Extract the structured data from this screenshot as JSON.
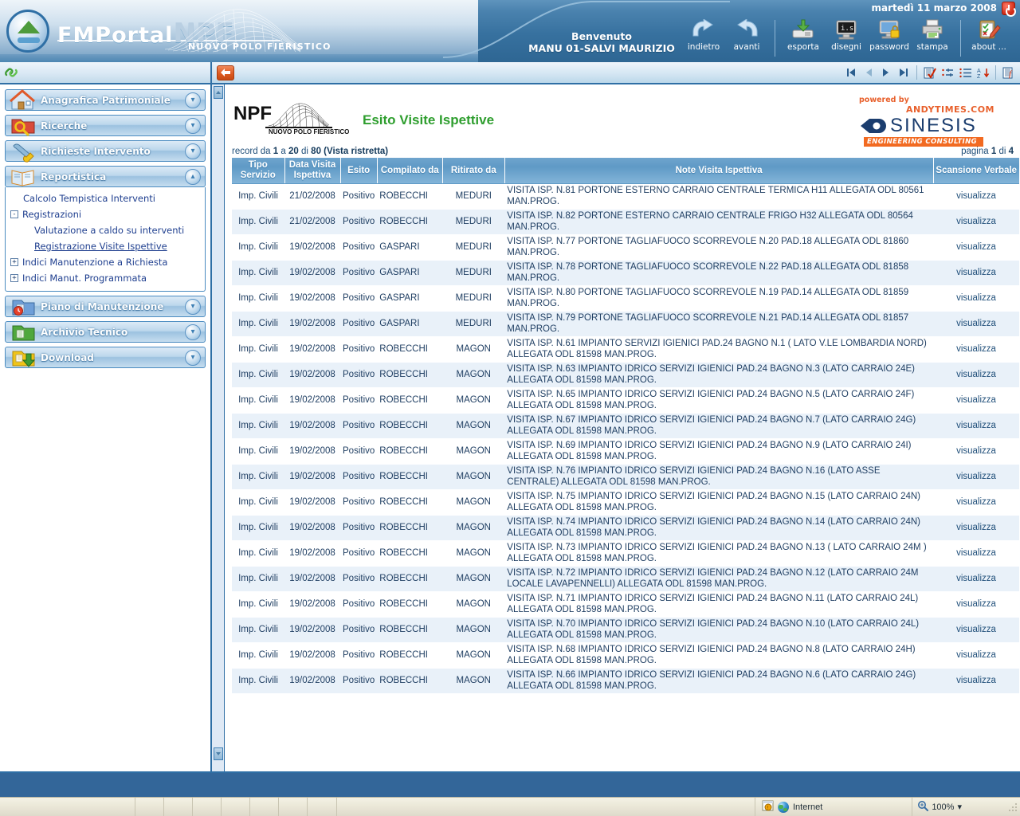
{
  "header": {
    "brand_fm": "FMPortal",
    "brand_npf": "NPF",
    "brand_sub": "NUOVO POLO FIERISTICO",
    "welcome_label": "Benvenuto",
    "welcome_user": "MANU 01-SALVI MAURIZIO",
    "date": "martedì 11 marzo 2008",
    "power_icon": "power-off-icon",
    "toolbar": [
      {
        "label": "indietro",
        "icon": "arrow-back-icon"
      },
      {
        "label": "avanti",
        "icon": "arrow-forward-icon"
      },
      {
        "label": "esporta",
        "icon": "export-disk-icon"
      },
      {
        "label": "disegni",
        "icon": "drawings-monitor-icon"
      },
      {
        "label": "password",
        "icon": "password-lock-icon"
      },
      {
        "label": "stampa",
        "icon": "printer-icon"
      },
      {
        "label": "about ...",
        "icon": "about-clipboard-icon"
      }
    ]
  },
  "subbar": {
    "link_icon": "link-chain-icon",
    "back_icon": "back-arrow-icon",
    "nav": [
      {
        "name": "first-record",
        "icon": "first-icon"
      },
      {
        "name": "previous-record",
        "icon": "previous-icon"
      },
      {
        "name": "next-record",
        "icon": "next-icon"
      },
      {
        "name": "last-record",
        "icon": "last-icon"
      },
      {
        "name": "validate",
        "icon": "checklist-icon"
      },
      {
        "name": "filter",
        "icon": "filter-icon"
      },
      {
        "name": "list-view",
        "icon": "list-icon"
      },
      {
        "name": "sort-az",
        "icon": "sort-az-icon"
      },
      {
        "name": "function",
        "icon": "function-icon"
      }
    ]
  },
  "sidebar": {
    "groups": [
      {
        "label": "Anagrafica Patrimoniale",
        "icon": "house-icon",
        "expanded": false,
        "chevron": "chevron-down-icon"
      },
      {
        "label": "Ricerche",
        "icon": "search-folder-icon",
        "expanded": false,
        "chevron": "chevron-down-icon"
      },
      {
        "label": "Richieste Intervento",
        "icon": "wrench-icon",
        "expanded": false,
        "chevron": "chevron-down-icon"
      },
      {
        "label": "Reportistica",
        "icon": "book-icon",
        "expanded": true,
        "chevron": "chevron-up-icon"
      },
      {
        "label": "Piano di Manutenzione",
        "icon": "calendar-clock-icon",
        "expanded": false,
        "chevron": "chevron-down-icon"
      },
      {
        "label": "Archivio Tecnico",
        "icon": "green-folder-icon",
        "expanded": false,
        "chevron": "chevron-down-icon"
      },
      {
        "label": "Download",
        "icon": "download-folder-icon",
        "expanded": false,
        "chevron": "chevron-down-icon"
      }
    ],
    "reportistica_items": [
      {
        "label": "Calcolo Tempistica Interventi",
        "indent": 1,
        "toggle": null,
        "active": false
      },
      {
        "label": "Registrazioni",
        "indent": 0,
        "toggle": "-",
        "active": false
      },
      {
        "label": "Valutazione a caldo su interventi",
        "indent": 2,
        "toggle": null,
        "active": false
      },
      {
        "label": "Registrazione Visite Ispettive",
        "indent": 2,
        "toggle": null,
        "active": true
      },
      {
        "label": "Indici Manutenzione a Richiesta",
        "indent": 0,
        "toggle": "+",
        "active": false
      },
      {
        "label": "Indici Manut. Programmata",
        "indent": 0,
        "toggle": "+",
        "active": false
      }
    ]
  },
  "main": {
    "logo_npf": "NPF",
    "logo_npf_sub": "NUOVO POLO FIERISTICO",
    "title": "Esito Visite Ispettive",
    "sinesis": {
      "powered_by": "powered by",
      "andytimes": "ANDYTIMES.COM",
      "name": "SINESIS",
      "tagline": "ENGINEERING CONSULTING"
    },
    "records_prefix": "record da",
    "records_from": "1",
    "records_mid": "a",
    "records_to": "20",
    "records_of": "di",
    "records_total": "80",
    "records_view": "(Vista ristretta)",
    "page_prefix": "pagina",
    "page_current": "1",
    "page_sep": "di",
    "page_total": "4",
    "columns": [
      "Tipo Servizio",
      "Data Visita Ispettiva",
      "Esito",
      "Compilato da",
      "Ritirato da",
      "Note Visita Ispettiva",
      "Scansione Verbale"
    ],
    "link_label": "visualizza",
    "rows": [
      {
        "tipo": "Imp. Civili",
        "data": "21/02/2008",
        "esito": "Positivo",
        "compilato": "ROBECCHI",
        "ritirato": "MEDURI",
        "note": "VISITA ISP. N.81 PORTONE ESTERNO CARRAIO CENTRALE TERMICA H11 ALLEGATA ODL 80561 MAN.PROG.",
        "scansione": "visualizza"
      },
      {
        "tipo": "Imp. Civili",
        "data": "21/02/2008",
        "esito": "Positivo",
        "compilato": "ROBECCHI",
        "ritirato": "MEDURI",
        "note": "VISITA ISP. N.82 PORTONE ESTERNO CARRAIO CENTRALE FRIGO H32 ALLEGATA ODL 80564 MAN.PROG.",
        "scansione": "visualizza"
      },
      {
        "tipo": "Imp. Civili",
        "data": "19/02/2008",
        "esito": "Positivo",
        "compilato": "GASPARI",
        "ritirato": "MEDURI",
        "note": "VISITA ISP. N.77 PORTONE TAGLIAFUOCO SCORREVOLE N.20 PAD.18 ALLEGATA ODL 81860 MAN.PROG.",
        "scansione": "visualizza"
      },
      {
        "tipo": "Imp. Civili",
        "data": "19/02/2008",
        "esito": "Positivo",
        "compilato": "GASPARI",
        "ritirato": "MEDURI",
        "note": "VISITA ISP. N.78 PORTONE TAGLIAFUOCO SCORREVOLE N.22 PAD.18 ALLEGATA ODL 81858 MAN.PROG.",
        "scansione": "visualizza"
      },
      {
        "tipo": "Imp. Civili",
        "data": "19/02/2008",
        "esito": "Positivo",
        "compilato": "GASPARI",
        "ritirato": "MEDURI",
        "note": "VISITA ISP. N.80 PORTONE TAGLIAFUOCO SCORREVOLE N.19 PAD.14 ALLEGATA ODL 81859 MAN.PROG.",
        "scansione": "visualizza"
      },
      {
        "tipo": "Imp. Civili",
        "data": "19/02/2008",
        "esito": "Positivo",
        "compilato": "GASPARI",
        "ritirato": "MEDURI",
        "note": "VISITA ISP. N.79 PORTONE TAGLIAFUOCO SCORREVOLE N.21 PAD.14 ALLEGATA ODL 81857 MAN.PROG.",
        "scansione": "visualizza"
      },
      {
        "tipo": "Imp. Civili",
        "data": "19/02/2008",
        "esito": "Positivo",
        "compilato": "ROBECCHI",
        "ritirato": "MAGON",
        "note": "VISITA ISP. N.61 IMPIANTO SERVIZI IGIENICI PAD.24 BAGNO N.1 ( LATO V.LE LOMBARDIA NORD) ALLEGATA ODL 81598 MAN.PROG.",
        "scansione": "visualizza"
      },
      {
        "tipo": "Imp. Civili",
        "data": "19/02/2008",
        "esito": "Positivo",
        "compilato": "ROBECCHI",
        "ritirato": "MAGON",
        "note": "VISITA ISP. N.63 IMPIANTO IDRICO SERVIZI IGIENICI PAD.24 BAGNO N.3 (LATO CARRAIO 24E) ALLEGATA ODL 81598 MAN.PROG.",
        "scansione": "visualizza"
      },
      {
        "tipo": "Imp. Civili",
        "data": "19/02/2008",
        "esito": "Positivo",
        "compilato": "ROBECCHI",
        "ritirato": "MAGON",
        "note": "VISITA ISP. N.65 IMPIANTO IDRICO SERVIZI IGIENICI PAD.24 BAGNO N.5 (LATO CARRAIO 24F) ALLEGATA ODL 81598 MAN.PROG.",
        "scansione": "visualizza"
      },
      {
        "tipo": "Imp. Civili",
        "data": "19/02/2008",
        "esito": "Positivo",
        "compilato": "ROBECCHI",
        "ritirato": "MAGON",
        "note": "VISITA ISP. N.67 IMPIANTO IDRICO SERVIZI IGIENICI PAD.24 BAGNO N.7 (LATO CARRAIO 24G) ALLEGATA ODL 81598 MAN.PROG.",
        "scansione": "visualizza"
      },
      {
        "tipo": "Imp. Civili",
        "data": "19/02/2008",
        "esito": "Positivo",
        "compilato": "ROBECCHI",
        "ritirato": "MAGON",
        "note": "VISITA ISP. N.69 IMPIANTO IDRICO SERVIZI IGIENICI PAD.24 BAGNO N.9 (LATO CARRAIO 24I) ALLEGATA ODL 81598 MAN.PROG.",
        "scansione": "visualizza"
      },
      {
        "tipo": "Imp. Civili",
        "data": "19/02/2008",
        "esito": "Positivo",
        "compilato": "ROBECCHI",
        "ritirato": "MAGON",
        "note": "VISITA ISP. N.76 IMPIANTO IDRICO SERVIZI IGIENICI PAD.24 BAGNO N.16 (LATO ASSE CENTRALE) ALLEGATA ODL 81598 MAN.PROG.",
        "scansione": "visualizza"
      },
      {
        "tipo": "Imp. Civili",
        "data": "19/02/2008",
        "esito": "Positivo",
        "compilato": "ROBECCHI",
        "ritirato": "MAGON",
        "note": "VISITA ISP. N.75 IMPIANTO IDRICO SERVIZI IGIENICI PAD.24 BAGNO N.15 (LATO CARRAIO 24N) ALLEGATA ODL 81598 MAN.PROG.",
        "scansione": "visualizza"
      },
      {
        "tipo": "Imp. Civili",
        "data": "19/02/2008",
        "esito": "Positivo",
        "compilato": "ROBECCHI",
        "ritirato": "MAGON",
        "note": "VISITA ISP. N.74 IMPIANTO IDRICO SERVIZI IGIENICI PAD.24 BAGNO N.14 (LATO CARRAIO 24N) ALLEGATA ODL 81598 MAN.PROG.",
        "scansione": "visualizza"
      },
      {
        "tipo": "Imp. Civili",
        "data": "19/02/2008",
        "esito": "Positivo",
        "compilato": "ROBECCHI",
        "ritirato": "MAGON",
        "note": "VISITA ISP. N.73 IMPIANTO IDRICO SERVIZI IGIENICI PAD.24 BAGNO N.13 ( LATO CARRAIO 24M ) ALLEGATA ODL 81598 MAN.PROG.",
        "scansione": "visualizza"
      },
      {
        "tipo": "Imp. Civili",
        "data": "19/02/2008",
        "esito": "Positivo",
        "compilato": "ROBECCHI",
        "ritirato": "MAGON",
        "note": "VISITA ISP. N.72 IMPIANTO IDRICO SERVIZI IGIENICI PAD.24 BAGNO N.12 (LATO CARRAIO 24M LOCALE LAVAPENNELLI) ALLEGATA ODL 81598 MAN.PROG.",
        "scansione": "visualizza"
      },
      {
        "tipo": "Imp. Civili",
        "data": "19/02/2008",
        "esito": "Positivo",
        "compilato": "ROBECCHI",
        "ritirato": "MAGON",
        "note": "VISITA ISP. N.71 IMPIANTO IDRICO SERVIZI IGIENICI PAD.24 BAGNO N.11 (LATO CARRAIO 24L) ALLEGATA ODL 81598 MAN.PROG.",
        "scansione": "visualizza"
      },
      {
        "tipo": "Imp. Civili",
        "data": "19/02/2008",
        "esito": "Positivo",
        "compilato": "ROBECCHI",
        "ritirato": "MAGON",
        "note": "VISITA ISP. N.70 IMPIANTO IDRICO SERVIZI IGIENICI PAD.24 BAGNO N.10 (LATO CARRAIO 24L) ALLEGATA ODL 81598 MAN.PROG.",
        "scansione": "visualizza"
      },
      {
        "tipo": "Imp. Civili",
        "data": "19/02/2008",
        "esito": "Positivo",
        "compilato": "ROBECCHI",
        "ritirato": "MAGON",
        "note": "VISITA ISP. N.68 IMPIANTO IDRICO SERVIZI IGIENICI PAD.24 BAGNO N.8 (LATO CARRAIO 24H) ALLEGATA ODL 81598 MAN.PROG.",
        "scansione": "visualizza"
      },
      {
        "tipo": "Imp. Civili",
        "data": "19/02/2008",
        "esito": "Positivo",
        "compilato": "ROBECCHI",
        "ritirato": "MAGON",
        "note": "VISITA ISP. N.66 IMPIANTO IDRICO SERVIZI IGIENICI PAD.24 BAGNO N.6 (LATO CARRAIO 24G) ALLEGATA ODL 81598 MAN.PROG.",
        "scansione": "visualizza"
      }
    ]
  },
  "statusbar": {
    "zone": "Internet",
    "zone_icon": "globe-icon",
    "security_icon": "security-icon",
    "zoom": "100%",
    "zoom_icon": "zoom-icon",
    "zoom_caret": "caret-down-icon"
  },
  "colors": {
    "header_blue": "#336699",
    "accent_green": "#2e9e2e",
    "table_header": "#6fa4cd",
    "row_alt": "#e9f1f9",
    "link": "#1f4e79",
    "orange": "#f26a21"
  }
}
